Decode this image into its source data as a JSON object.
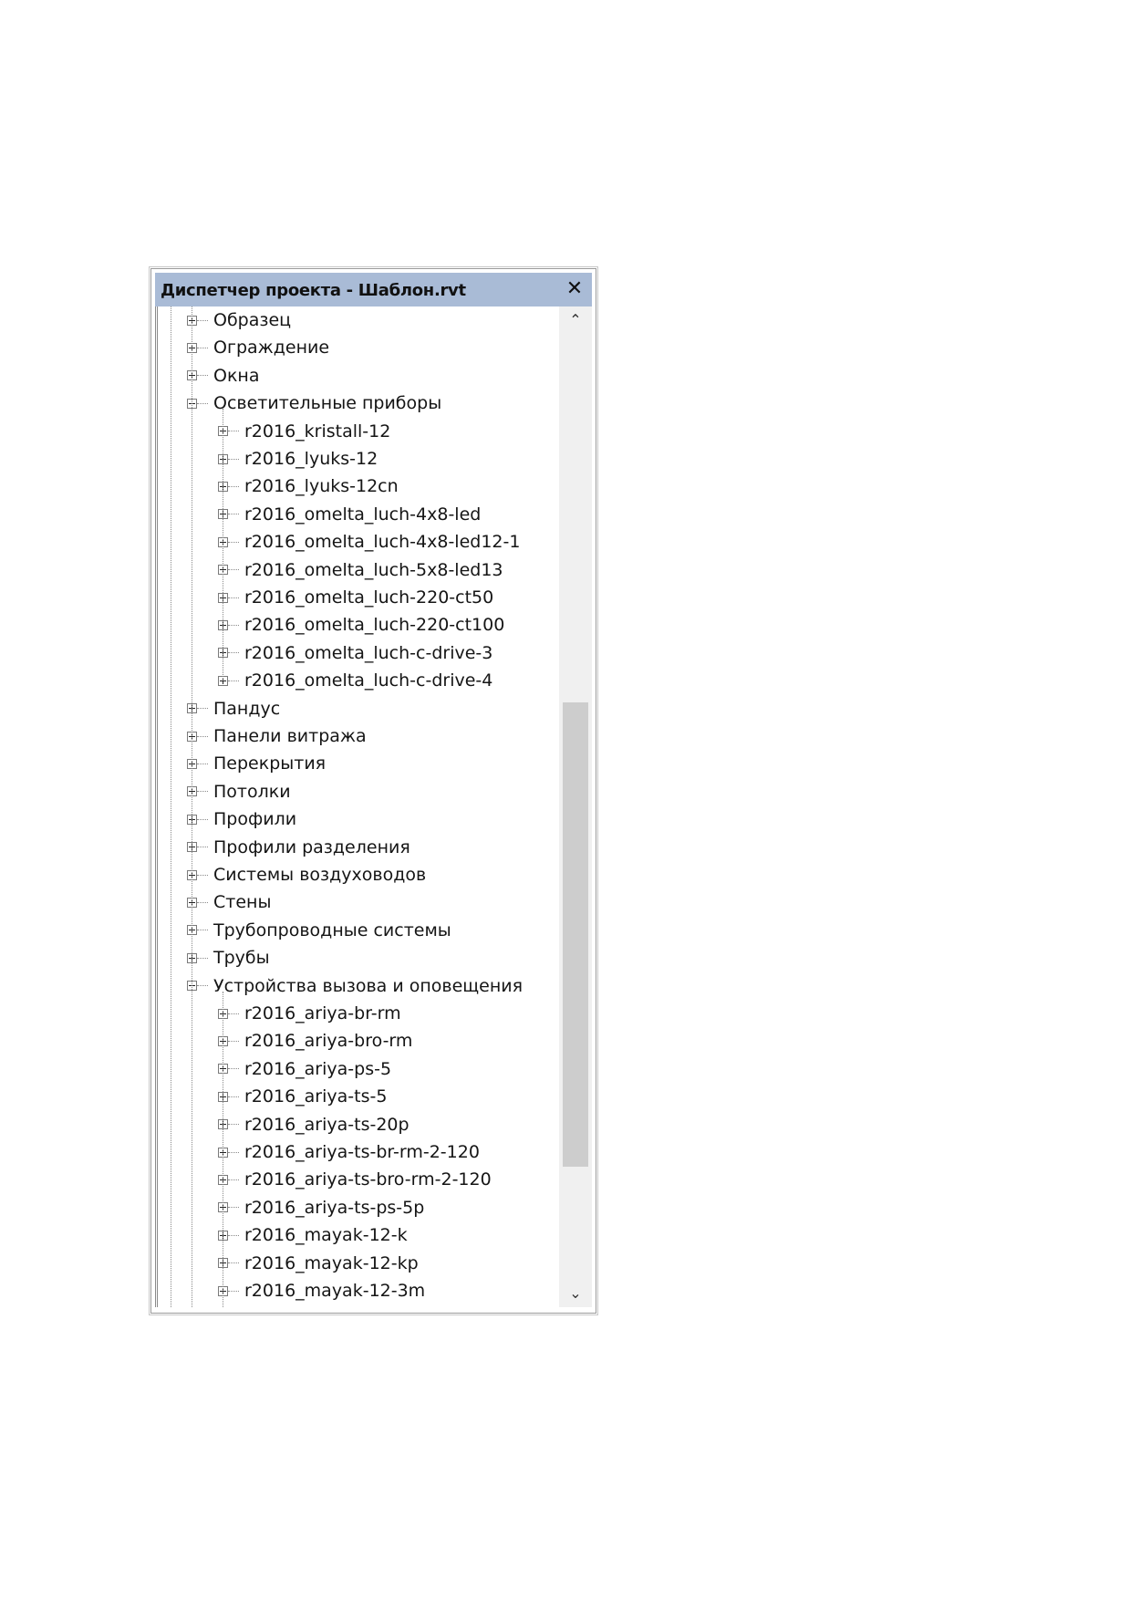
{
  "window": {
    "title": "Диспетчер проекта - Шаблон.rvt",
    "close_glyph": "✕"
  },
  "scrollbar": {
    "up_glyph": "⌃",
    "down_glyph": "⌄",
    "thumb_start_fraction": 0.39,
    "thumb_end_fraction": 0.88
  },
  "tree": [
    {
      "label": "Образец",
      "level": 1,
      "expanded": false
    },
    {
      "label": "Ограждение",
      "level": 1,
      "expanded": false
    },
    {
      "label": "Окна",
      "level": 1,
      "expanded": false
    },
    {
      "label": "Осветительные приборы",
      "level": 1,
      "expanded": true
    },
    {
      "label": "r2016_kristall-12",
      "level": 2,
      "expanded": false
    },
    {
      "label": "r2016_lyuks-12",
      "level": 2,
      "expanded": false
    },
    {
      "label": "r2016_lyuks-12cn",
      "level": 2,
      "expanded": false
    },
    {
      "label": "r2016_omelta_luch-4x8-led",
      "level": 2,
      "expanded": false
    },
    {
      "label": "r2016_omelta_luch-4x8-led12-1",
      "level": 2,
      "expanded": false
    },
    {
      "label": "r2016_omelta_luch-5x8-led13",
      "level": 2,
      "expanded": false
    },
    {
      "label": "r2016_omelta_luch-220-ct50",
      "level": 2,
      "expanded": false
    },
    {
      "label": "r2016_omelta_luch-220-ct100",
      "level": 2,
      "expanded": false
    },
    {
      "label": "r2016_omelta_luch-c-drive-3",
      "level": 2,
      "expanded": false
    },
    {
      "label": "r2016_omelta_luch-c-drive-4",
      "level": 2,
      "expanded": false
    },
    {
      "label": "Пандус",
      "level": 1,
      "expanded": false
    },
    {
      "label": "Панели витража",
      "level": 1,
      "expanded": false
    },
    {
      "label": "Перекрытия",
      "level": 1,
      "expanded": false
    },
    {
      "label": "Потолки",
      "level": 1,
      "expanded": false
    },
    {
      "label": "Профили",
      "level": 1,
      "expanded": false
    },
    {
      "label": "Профили разделения",
      "level": 1,
      "expanded": false
    },
    {
      "label": "Системы воздуховодов",
      "level": 1,
      "expanded": false
    },
    {
      "label": "Стены",
      "level": 1,
      "expanded": false
    },
    {
      "label": "Трубопроводные системы",
      "level": 1,
      "expanded": false
    },
    {
      "label": "Трубы",
      "level": 1,
      "expanded": false
    },
    {
      "label": "Устройства вызова и оповещения",
      "level": 1,
      "expanded": true
    },
    {
      "label": "r2016_ariya-br-rm",
      "level": 2,
      "expanded": false
    },
    {
      "label": "r2016_ariya-bro-rm",
      "level": 2,
      "expanded": false
    },
    {
      "label": "r2016_ariya-ps-5",
      "level": 2,
      "expanded": false
    },
    {
      "label": "r2016_ariya-ts-5",
      "level": 2,
      "expanded": false
    },
    {
      "label": "r2016_ariya-ts-20p",
      "level": 2,
      "expanded": false
    },
    {
      "label": "r2016_ariya-ts-br-rm-2-120",
      "level": 2,
      "expanded": false
    },
    {
      "label": "r2016_ariya-ts-bro-rm-2-120",
      "level": 2,
      "expanded": false
    },
    {
      "label": "r2016_ariya-ts-ps-5p",
      "level": 2,
      "expanded": false
    },
    {
      "label": "r2016_mayak-12-k",
      "level": 2,
      "expanded": false
    },
    {
      "label": "r2016_mayak-12-kp",
      "level": 2,
      "expanded": false
    },
    {
      "label": "r2016_mayak-12-3m",
      "level": 2,
      "expanded": false
    }
  ]
}
